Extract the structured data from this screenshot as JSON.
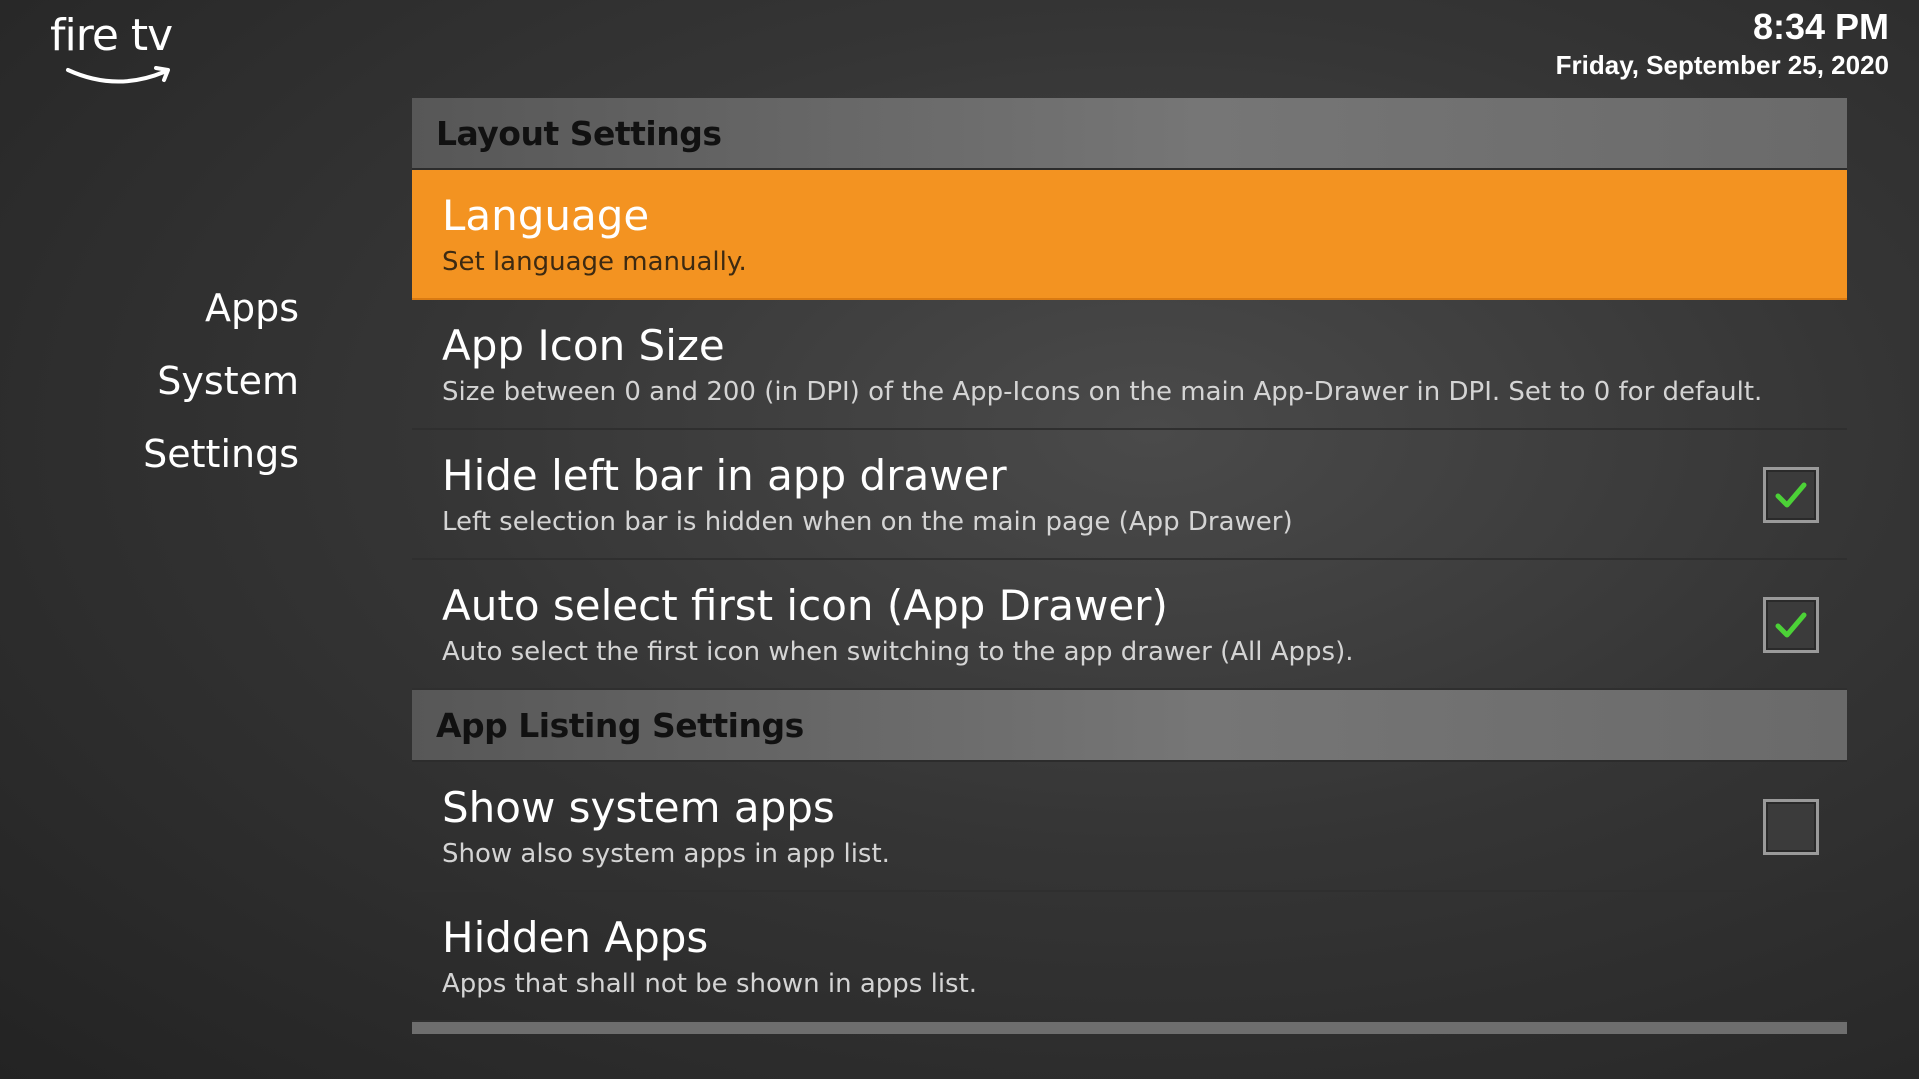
{
  "logo": {
    "text": "fire tv",
    "icon": "amazon-smile-icon"
  },
  "clock": {
    "time": "8:34 PM",
    "date": "Friday, September 25, 2020"
  },
  "nav": {
    "items": [
      {
        "label": "Apps"
      },
      {
        "label": "System"
      },
      {
        "label": "Settings"
      }
    ]
  },
  "sections": {
    "layout": {
      "header": "Layout Settings",
      "items": [
        {
          "title": "Language",
          "desc": "Set language manually.",
          "selected": true
        },
        {
          "title": "App Icon Size",
          "desc": "Size between 0 and 200 (in DPI) of the App-Icons on the main App-Drawer in DPI. Set to 0 for default."
        },
        {
          "title": "Hide left bar in app drawer",
          "desc": "Left selection bar is hidden when on the main page (App Drawer)",
          "checked": true
        },
        {
          "title": "Auto select first icon (App Drawer)",
          "desc": "Auto select the first icon when switching to the app drawer (All Apps).",
          "checked": true
        }
      ]
    },
    "listing": {
      "header": "App Listing Settings",
      "items": [
        {
          "title": "Show system apps",
          "desc": "Show also system apps in app list.",
          "checked": false
        },
        {
          "title": "Hidden Apps",
          "desc": "Apps that shall not be shown in apps list."
        }
      ]
    }
  },
  "colors": {
    "accent": "#f39321",
    "checkmark": "#4cd137",
    "header_bg": "#767676"
  }
}
